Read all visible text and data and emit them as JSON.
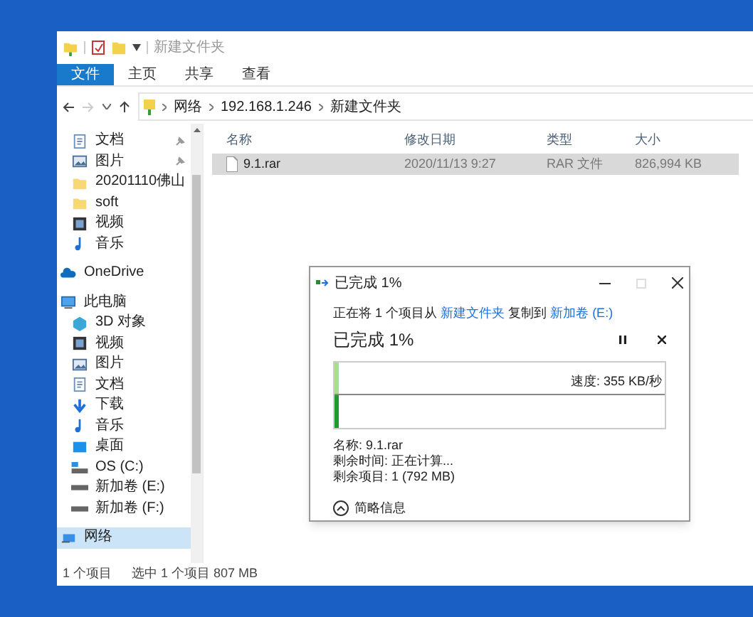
{
  "window": {
    "title": "新建文件夹"
  },
  "ribbon_tabs": [
    {
      "label": "文件",
      "selected": true
    },
    {
      "label": "主页",
      "selected": false
    },
    {
      "label": "共享",
      "selected": false
    },
    {
      "label": "查看",
      "selected": false
    }
  ],
  "breadcrumb": [
    "网络",
    "192.168.1.246",
    "新建文件夹"
  ],
  "sidebar": {
    "quick_access": [
      {
        "label": "文档",
        "kind": "document",
        "pinned": true
      },
      {
        "label": "图片",
        "kind": "picture",
        "pinned": true
      },
      {
        "label": "20201110佛山",
        "kind": "folder",
        "pinned": false
      },
      {
        "label": "soft",
        "kind": "folder",
        "pinned": false
      },
      {
        "label": "视频",
        "kind": "video",
        "pinned": false
      },
      {
        "label": "音乐",
        "kind": "music",
        "pinned": false
      }
    ],
    "items": [
      {
        "label": "OneDrive",
        "kind": "cloud",
        "selected": false
      },
      {
        "label": "此电脑",
        "kind": "pc",
        "selected": false,
        "children": [
          {
            "label": "3D 对象",
            "kind": "cube"
          },
          {
            "label": "视频",
            "kind": "video"
          },
          {
            "label": "图片",
            "kind": "picture"
          },
          {
            "label": "文档",
            "kind": "document"
          },
          {
            "label": "下载",
            "kind": "download"
          },
          {
            "label": "音乐",
            "kind": "music"
          },
          {
            "label": "桌面",
            "kind": "desktop"
          },
          {
            "label": "OS (C:)",
            "kind": "osdrive"
          },
          {
            "label": "新加卷 (E:)",
            "kind": "drive"
          },
          {
            "label": "新加卷 (F:)",
            "kind": "drive"
          }
        ]
      },
      {
        "label": "网络",
        "kind": "network",
        "selected": true
      }
    ]
  },
  "table": {
    "columns": [
      "名称",
      "修改日期",
      "类型",
      "大小"
    ],
    "rows": [
      {
        "name": "9.1.rar",
        "modified": "2020/11/13 9:27",
        "type": "RAR 文件",
        "size": "826,994 KB",
        "selected": true
      }
    ]
  },
  "status_bar": [
    "1 个项目",
    "选中 1 个项目 807 MB"
  ],
  "copy_dialog": {
    "title": "已完成 1%",
    "line": {
      "prefix": "正在将 1 个项目从",
      "source": "新建文件夹",
      "middle": "复制到",
      "target": "新加卷 (E:)"
    },
    "heading": "已完成 1%",
    "speed": "速度: 355 KB/秒",
    "level": 0.01,
    "details": [
      "名称: 9.1.rar",
      "剩余时间: 正在计算...",
      "剩余项目: 1 (792 MB)"
    ],
    "less_details": "简略信息"
  }
}
